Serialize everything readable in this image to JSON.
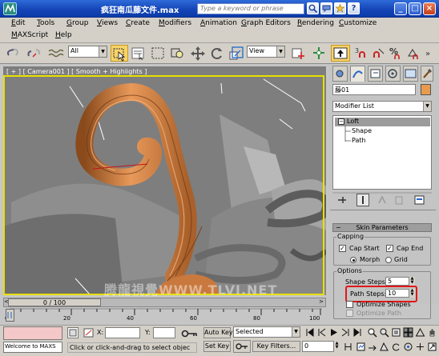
{
  "title": {
    "filename": "疯狂南瓜藤文件.max",
    "search_placeholder": "Type a keyword or phrase"
  },
  "menu": {
    "row1": [
      "Edit",
      "Tools",
      "Group",
      "Views",
      "Create",
      "Modifiers",
      "Animation",
      "Graph Editors",
      "Rendering",
      "Customize"
    ],
    "row2": [
      "MAXScript",
      "Help"
    ]
  },
  "toolbar": {
    "selection_filter": "All",
    "ref_coord": "View"
  },
  "viewport": {
    "label": "[ + ] [ Camera001 ] [ Smooth + Highlights ]",
    "watermark": "腾龍視覺WWW.TLVI.NET"
  },
  "command_panel": {
    "object_name": "藤01",
    "object_color": "#e89a4e",
    "modifier_list": "Modifier List",
    "stack": {
      "root": "Loft",
      "children": [
        "Shape",
        "Path"
      ]
    },
    "rollout_title": "Skin Parameters",
    "capping_group": "Capping",
    "cap_start": "Cap Start",
    "cap_end": "Cap End",
    "morph": "Morph",
    "grid": "Grid",
    "options_group": "Options",
    "shape_steps_label": "Shape Steps:",
    "shape_steps_value": "5",
    "path_steps_label": "Path Steps:",
    "path_steps_value": "10",
    "optimize_shapes": "Optimize Shapes",
    "optimize_path": "Optimize Path"
  },
  "timeline": {
    "frame_display": "0 / 100",
    "ticks": [
      "0",
      "20",
      "40",
      "60",
      "80",
      "100"
    ]
  },
  "status": {
    "listener_text": "Welcome to MAXS",
    "prompt": "Click or click-and-drag to select objec",
    "x_label": "X:",
    "y_label": "Y:",
    "auto_key": "Auto Key",
    "set_key": "Set Key",
    "key_mode": "Selected",
    "key_filters": "Key Filters...",
    "current_frame": "0"
  }
}
